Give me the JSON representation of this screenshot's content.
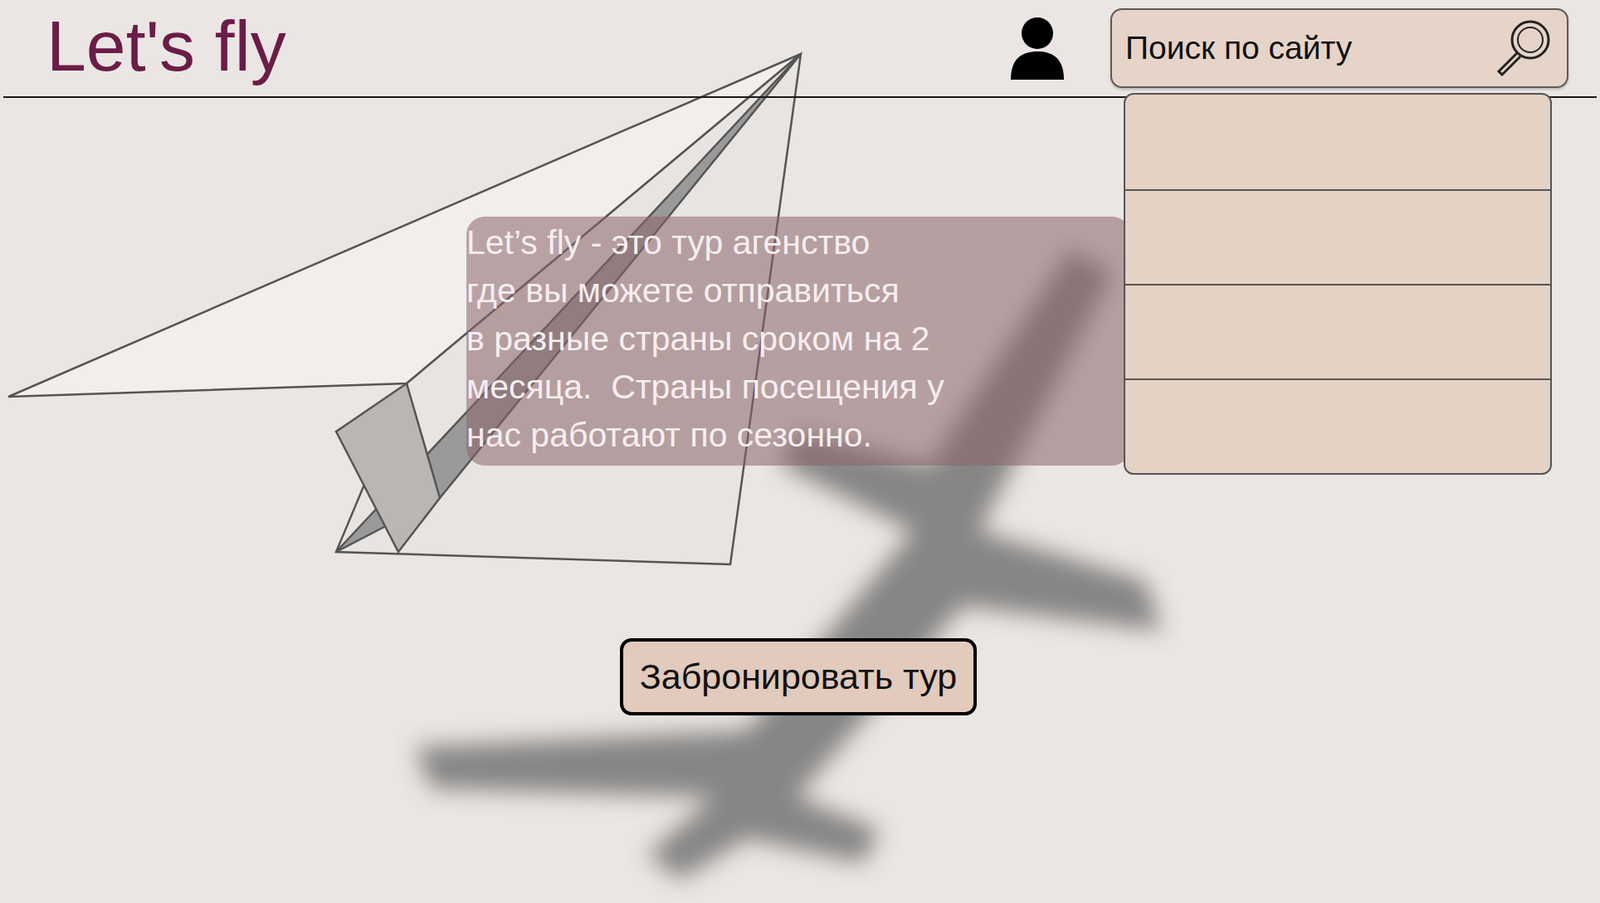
{
  "logo": "Let's fly",
  "search": {
    "placeholder": "Поиск по сайту"
  },
  "search_suggestions": [
    "",
    "",
    "",
    ""
  ],
  "intro": {
    "lines": [
      "Let’s fly - это тур агенство",
      "где вы можете отправиться",
      "в разные страны сроком на 2",
      "месяца.  Страны посещения у",
      "нас работают по сезонно."
    ]
  },
  "buttons": [
    "Забронировать тур"
  ]
}
